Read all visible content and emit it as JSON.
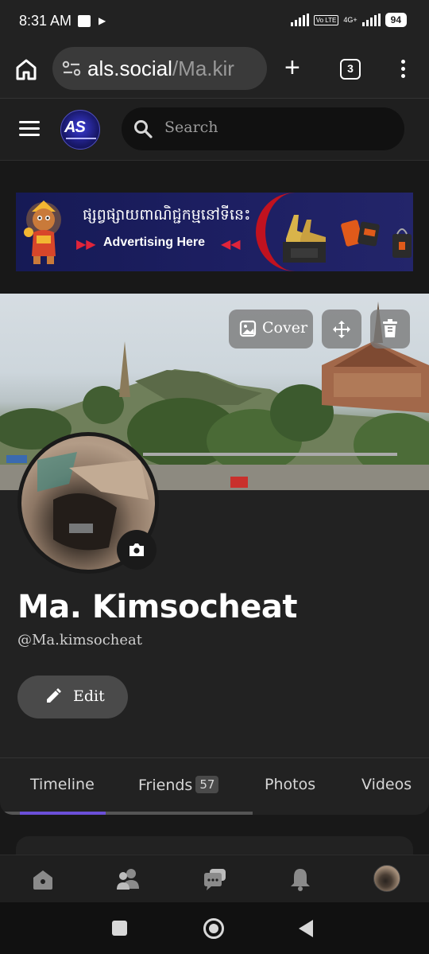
{
  "status_bar": {
    "time": "8:31 AM",
    "volte_label": "Vo LTE",
    "network_label": "4G+",
    "battery": "94"
  },
  "browser": {
    "url_host": "als.social",
    "url_path": "/Ma.kir",
    "tab_count": "3"
  },
  "header": {
    "logo_text": "AS",
    "search_placeholder": "Search"
  },
  "ad": {
    "khmer_text": "ផ្សព្វផ្សាយពាណិជ្ជកម្មនៅទីនេះ",
    "english_text": "Advertising Here",
    "arrows_left": "▶▶",
    "arrows_right": "◀◀"
  },
  "cover": {
    "cover_button_label": "Cover"
  },
  "profile": {
    "name": "Ma. Kimsocheat",
    "handle": "@Ma.kimsocheat",
    "edit_label": "Edit"
  },
  "tabs": [
    {
      "label": "Timeline"
    },
    {
      "label": "Friends",
      "badge": "57"
    },
    {
      "label": "Photos"
    },
    {
      "label": "Videos"
    }
  ],
  "theme": {
    "background": "#181818",
    "panel": "#222222",
    "accent": "#6b4fd8",
    "ad_red": "#e0243a"
  },
  "icons": {
    "bottom_nav": [
      "home-icon",
      "friends-icon",
      "chat-icon",
      "bell-icon",
      "profile-avatar"
    ],
    "cover_actions": [
      "image-icon",
      "move-icon",
      "trash-icon"
    ]
  }
}
